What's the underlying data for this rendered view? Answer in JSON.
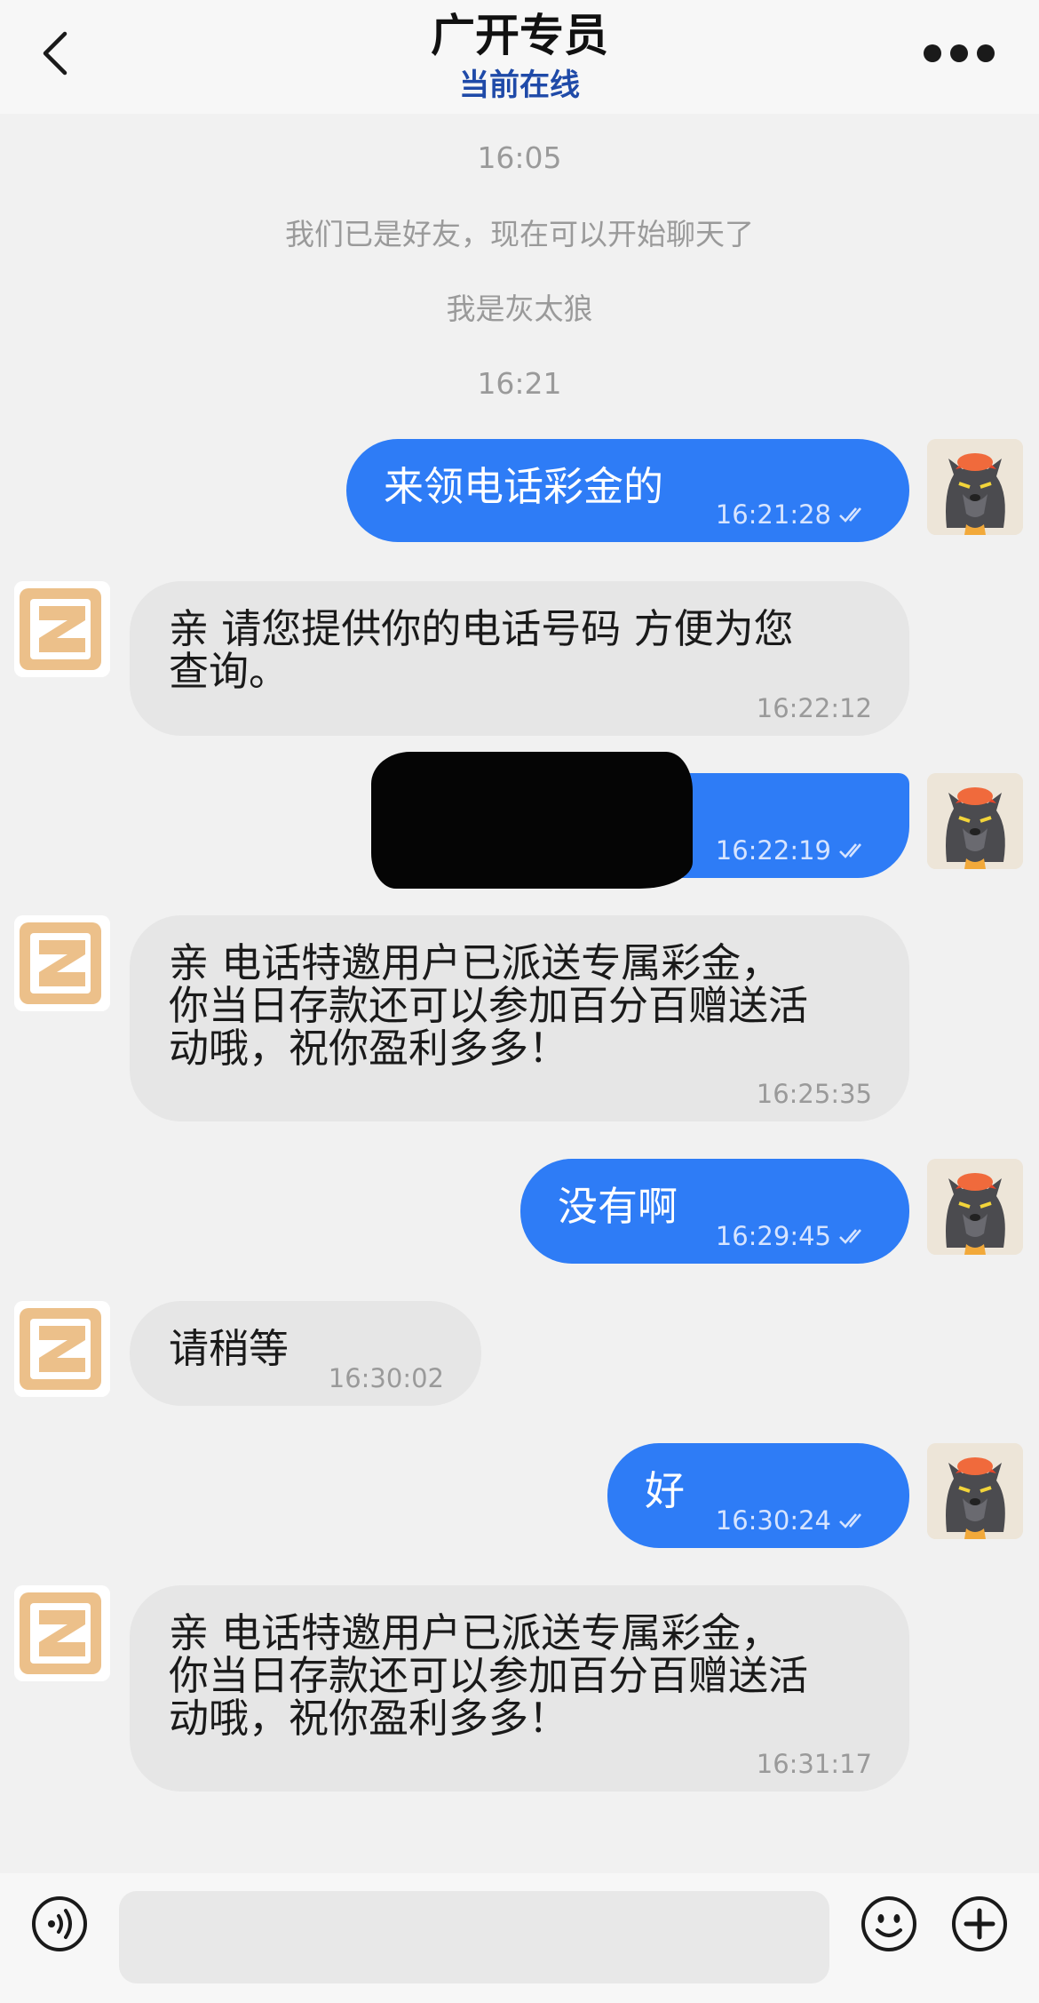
{
  "header": {
    "title": "广开专员",
    "status": "当前在线"
  },
  "system_messages": [
    {
      "text": "16:05"
    },
    {
      "text": "我们已是好友，现在可以开始聊天了"
    },
    {
      "text": "我是灰太狼"
    },
    {
      "text": "16:21"
    }
  ],
  "messages": [
    {
      "direction": "out",
      "text": "来领电话彩金的",
      "time": "16:21:28",
      "read": true
    },
    {
      "direction": "in",
      "text": "亲  请您提供你的电话号码  方便为您\n查询。",
      "time": "16:22:12"
    },
    {
      "direction": "out",
      "text": "",
      "redacted": true,
      "time": "16:22:19",
      "read": true
    },
    {
      "direction": "in",
      "text": "亲  电话特邀用户已派送专属彩金，\n你当日存款还可以参加百分百赠送活\n动哦，祝你盈利多多！",
      "time": "16:25:35"
    },
    {
      "direction": "out",
      "text": "没有啊",
      "time": "16:29:45",
      "read": true
    },
    {
      "direction": "in",
      "text": "请稍等",
      "time": "16:30:02"
    },
    {
      "direction": "out",
      "text": "好",
      "time": "16:30:24",
      "read": true
    },
    {
      "direction": "in",
      "text": "亲  电话特邀用户已派送专属彩金，\n你当日存款还可以参加百分百赠送活\n动哦，祝你盈利多多！",
      "time": "16:31:17"
    }
  ],
  "composer": {
    "placeholder": "",
    "icons": [
      "voice-icon",
      "emoji-icon",
      "plus-icon"
    ]
  },
  "colors": {
    "outgoing_bubble": "#2e7cf6",
    "incoming_bubble": "#e6e6e6",
    "online_status": "#1f4aa8",
    "background": "#f1f1f1"
  }
}
